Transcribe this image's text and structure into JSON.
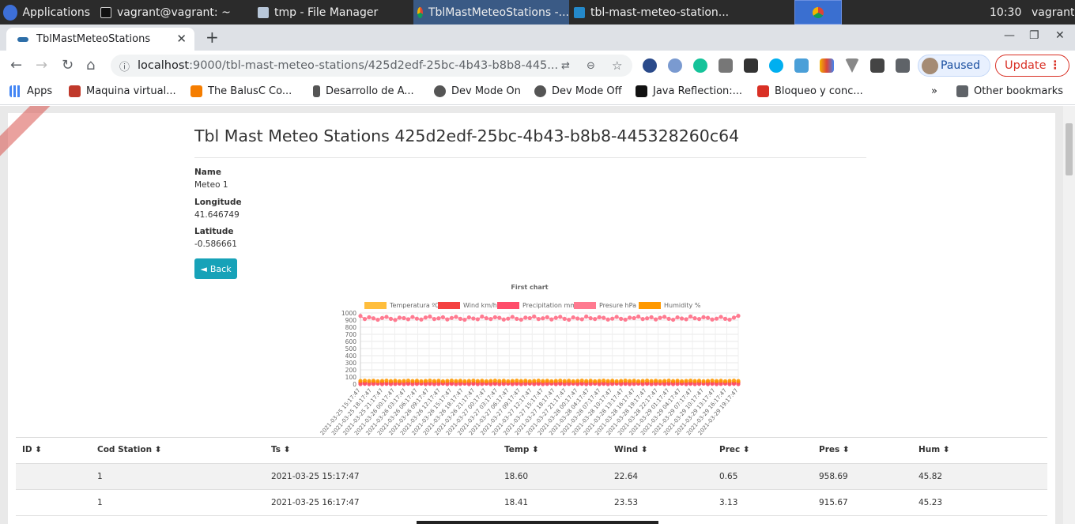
{
  "taskbar": {
    "applications": "Applications",
    "items": [
      "vagrant@vagrant: ~",
      "tmp - File Manager",
      "TblMastMeteoStations -...",
      "tbl-mast-meteo-station..."
    ],
    "clock": "10:30",
    "user": "vagrant"
  },
  "browser": {
    "tab_title": "TblMastMeteoStations",
    "url_host": "localhost",
    "url_path": ":9000/tbl-mast-meteo-stations/425d2edf-25bc-4b43-b8b8-445...",
    "paused": "Paused",
    "update": "Update",
    "bookmarks": [
      "Apps",
      "Maquina virtual...",
      "The BalusC Co...",
      "Desarrollo de A...",
      "Dev Mode On",
      "Dev Mode Off",
      "Java Reflection:...",
      "Bloqueo y conc..."
    ],
    "other_bookmarks": "Other bookmarks",
    "overflow": "»"
  },
  "page": {
    "title": "Tbl Mast Meteo Stations 425d2edf-25bc-4b43-b8b8-445328260c64",
    "name_label": "Name",
    "name_value": "Meteo 1",
    "longitude_label": "Longitude",
    "longitude_value": "41.646749",
    "latitude_label": "Latitude",
    "latitude_value": "-0.586661",
    "back_label": "Back"
  },
  "chart_data": {
    "type": "line",
    "title": "First chart",
    "ylim": [
      0,
      1000
    ],
    "yticks": [
      0,
      100,
      200,
      300,
      400,
      500,
      600,
      700,
      800,
      900,
      1000
    ],
    "series": [
      {
        "name": "Temperatura ºC",
        "color": "#ffbe3d",
        "value": 18.5
      },
      {
        "name": "Wind km/h",
        "color": "#f44141",
        "value": 23
      },
      {
        "name": "Precipitation mm",
        "color": "#ff4d6a",
        "value": 2
      },
      {
        "name": "Presure hPa",
        "color": "#ff7a90",
        "value": 930
      },
      {
        "name": "Humidity %",
        "color": "#ff9900",
        "value": 45
      }
    ],
    "x_labels": [
      "2021-03-25 15:17:47",
      "2021-03-25 18:17:47",
      "2021-03-25 21:17:47",
      "2021-03-26 00:17:47",
      "2021-03-26 03:17:47",
      "2021-03-26 06:17:47",
      "2021-03-26 09:17:47",
      "2021-03-26 12:17:47",
      "2021-03-26 15:17:47",
      "2021-03-26 18:17:47",
      "2021-03-26 21:17:47",
      "2021-03-27 00:17:47",
      "2021-03-27 03:17:47",
      "2021-03-27 06:17:47",
      "2021-03-27 09:17:47",
      "2021-03-27 12:17:47",
      "2021-03-27 15:17:47",
      "2021-03-27 18:17:47",
      "2021-03-27 21:17:47",
      "2021-03-28 00:17:47",
      "2021-03-28 04:17:47",
      "2021-03-28 07:17:47",
      "2021-03-28 10:17:47",
      "2021-03-28 13:17:47",
      "2021-03-28 16:17:47",
      "2021-03-28 19:17:47",
      "2021-03-28 22:17:47",
      "2021-03-29 01:17:47",
      "2021-03-29 04:17:47",
      "2021-03-29 07:17:47",
      "2021-03-29 10:17:47",
      "2021-03-29 13:17:47",
      "2021-03-29 16:17:47",
      "2021-03-29 19:17:47"
    ],
    "pressure_values": [
      958,
      915,
      940,
      925,
      905,
      930,
      945,
      918,
      902,
      935,
      928,
      912,
      944,
      920,
      908,
      936,
      950,
      915,
      925,
      940,
      910,
      930,
      946,
      918,
      905,
      938,
      922,
      912,
      950,
      926,
      915,
      940,
      932,
      908,
      920,
      945,
      918,
      906,
      935,
      928,
      950,
      915,
      925,
      940,
      910,
      932,
      946,
      918,
      905,
      938,
      922,
      912,
      950,
      926,
      915,
      940,
      932,
      908,
      920,
      945,
      918,
      906,
      935,
      928,
      950,
      915,
      925,
      940,
      910,
      932,
      946,
      918,
      905,
      938,
      922,
      912,
      950,
      926,
      915,
      940,
      932,
      908,
      920,
      945,
      918,
      906,
      935,
      960
    ]
  },
  "table": {
    "headers": [
      "ID",
      "Cod Station",
      "Ts",
      "Temp",
      "Wind",
      "Prec",
      "Pres",
      "Hum"
    ],
    "rows": [
      {
        "id": "",
        "cod": "1",
        "ts": "2021-03-25 15:17:47",
        "temp": "18.60",
        "wind": "22.64",
        "prec": "0.65",
        "pres": "958.69",
        "hum": "45.82"
      },
      {
        "id": "",
        "cod": "1",
        "ts": "2021-03-25 16:17:47",
        "temp": "18.41",
        "wind": "23.53",
        "prec": "3.13",
        "pres": "915.67",
        "hum": "45.23"
      }
    ]
  }
}
